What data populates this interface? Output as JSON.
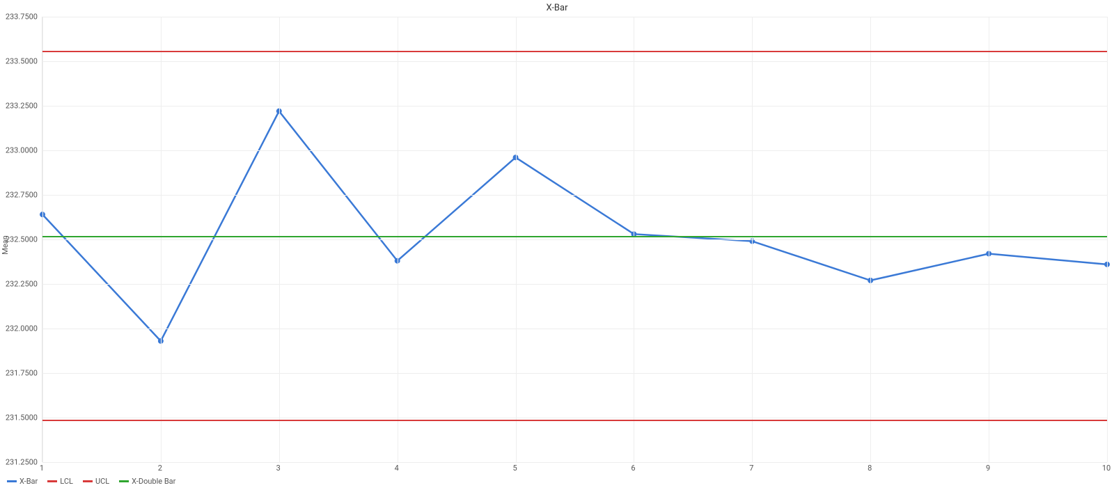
{
  "chart_data": {
    "type": "line",
    "title": "X-Bar",
    "xlabel": "",
    "ylabel": "Mean",
    "x": [
      1,
      2,
      3,
      4,
      5,
      6,
      7,
      8,
      9,
      10
    ],
    "series": [
      {
        "name": "X-Bar",
        "color": "#3a79d6",
        "markers": true,
        "values": [
          232.64,
          231.93,
          233.22,
          232.38,
          232.96,
          232.53,
          232.49,
          232.27,
          232.42,
          232.36
        ]
      },
      {
        "name": "LCL",
        "color": "#d83a3a",
        "markers": false,
        "values": [
          231.49,
          231.49,
          231.49,
          231.49,
          231.49,
          231.49,
          231.49,
          231.49,
          231.49,
          231.49
        ]
      },
      {
        "name": "UCL",
        "color": "#d83a3a",
        "markers": false,
        "values": [
          233.56,
          233.56,
          233.56,
          233.56,
          233.56,
          233.56,
          233.56,
          233.56,
          233.56,
          233.56
        ]
      },
      {
        "name": "X-Double Bar",
        "color": "#2fa52f",
        "markers": false,
        "values": [
          232.52,
          232.52,
          232.52,
          232.52,
          232.52,
          232.52,
          232.52,
          232.52,
          232.52,
          232.52
        ]
      }
    ],
    "y_ticks": [
      231.25,
      231.5,
      231.75,
      232.0,
      232.25,
      232.5,
      232.75,
      233.0,
      233.25,
      233.5,
      233.75
    ],
    "y_tick_labels": [
      "231.2500",
      "231.5000",
      "231.7500",
      "232.0000",
      "232.2500",
      "232.5000",
      "232.7500",
      "233.0000",
      "233.2500",
      "233.5000",
      "233.7500"
    ],
    "x_ticks": [
      1,
      2,
      3,
      4,
      5,
      6,
      7,
      8,
      9,
      10
    ],
    "ylim": [
      231.25,
      233.75
    ],
    "xlim": [
      1,
      10
    ],
    "legend_position": "bottom-left"
  }
}
